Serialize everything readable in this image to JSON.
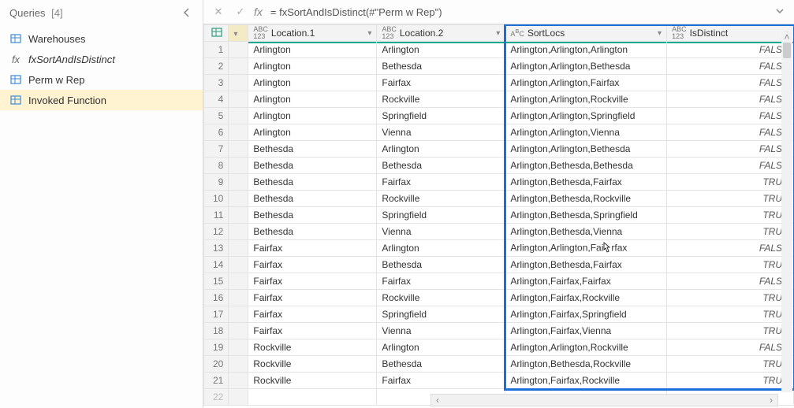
{
  "sidebar": {
    "title": "Queries",
    "count": "[4]",
    "items": [
      {
        "icon": "table",
        "label": "Warehouses"
      },
      {
        "icon": "fx",
        "label": "fxSortAndIsDistinct"
      },
      {
        "icon": "table",
        "label": "Perm w Rep"
      },
      {
        "icon": "table",
        "label": "Invoked Function"
      }
    ]
  },
  "formula": {
    "value": "= fxSortAndIsDistinct(#\"Perm w Rep\")"
  },
  "columns": [
    {
      "name": "Location.1",
      "typeicon": "ABC123"
    },
    {
      "name": "Location.2",
      "typeicon": "ABC123"
    },
    {
      "name": "SortLocs",
      "typeicon": "ABC"
    },
    {
      "name": "IsDistinct",
      "typeicon": "ABC123"
    }
  ],
  "rows": [
    {
      "n": 1,
      "c": [
        "Arlington",
        "Arlington",
        "Arlington,Arlington,Arlington",
        "FALSE"
      ]
    },
    {
      "n": 2,
      "c": [
        "Arlington",
        "Bethesda",
        "Arlington,Arlington,Bethesda",
        "FALSE"
      ]
    },
    {
      "n": 3,
      "c": [
        "Arlington",
        "Fairfax",
        "Arlington,Arlington,Fairfax",
        "FALSE"
      ]
    },
    {
      "n": 4,
      "c": [
        "Arlington",
        "Rockville",
        "Arlington,Arlington,Rockville",
        "FALSE"
      ]
    },
    {
      "n": 5,
      "c": [
        "Arlington",
        "Springfield",
        "Arlington,Arlington,Springfield",
        "FALSE"
      ]
    },
    {
      "n": 6,
      "c": [
        "Arlington",
        "Vienna",
        "Arlington,Arlington,Vienna",
        "FALSE"
      ]
    },
    {
      "n": 7,
      "c": [
        "Bethesda",
        "Arlington",
        "Arlington,Arlington,Bethesda",
        "FALSE"
      ]
    },
    {
      "n": 8,
      "c": [
        "Bethesda",
        "Bethesda",
        "Arlington,Bethesda,Bethesda",
        "FALSE"
      ]
    },
    {
      "n": 9,
      "c": [
        "Bethesda",
        "Fairfax",
        "Arlington,Bethesda,Fairfax",
        "TRUE"
      ]
    },
    {
      "n": 10,
      "c": [
        "Bethesda",
        "Rockville",
        "Arlington,Bethesda,Rockville",
        "TRUE"
      ]
    },
    {
      "n": 11,
      "c": [
        "Bethesda",
        "Springfield",
        "Arlington,Bethesda,Springfield",
        "TRUE"
      ]
    },
    {
      "n": 12,
      "c": [
        "Bethesda",
        "Vienna",
        "Arlington,Bethesda,Vienna",
        "TRUE"
      ]
    },
    {
      "n": 13,
      "c": [
        "Fairfax",
        "Arlington",
        "Arlington,Arlington,Fairfax",
        "FALSE"
      ]
    },
    {
      "n": 14,
      "c": [
        "Fairfax",
        "Bethesda",
        "Arlington,Bethesda,Fairfax",
        "TRUE"
      ]
    },
    {
      "n": 15,
      "c": [
        "Fairfax",
        "Fairfax",
        "Arlington,Fairfax,Fairfax",
        "FALSE"
      ]
    },
    {
      "n": 16,
      "c": [
        "Fairfax",
        "Rockville",
        "Arlington,Fairfax,Rockville",
        "TRUE"
      ]
    },
    {
      "n": 17,
      "c": [
        "Fairfax",
        "Springfield",
        "Arlington,Fairfax,Springfield",
        "TRUE"
      ]
    },
    {
      "n": 18,
      "c": [
        "Fairfax",
        "Vienna",
        "Arlington,Fairfax,Vienna",
        "TRUE"
      ]
    },
    {
      "n": 19,
      "c": [
        "Rockville",
        "Arlington",
        "Arlington,Arlington,Rockville",
        "FALSE"
      ]
    },
    {
      "n": 20,
      "c": [
        "Rockville",
        "Bethesda",
        "Arlington,Bethesda,Rockville",
        "TRUE"
      ]
    },
    {
      "n": 21,
      "c": [
        "Rockville",
        "Fairfax",
        "Arlington,Fairfax,Rockville",
        "TRUE"
      ]
    }
  ],
  "cursor_row": 13,
  "chart_data": {
    "type": "table",
    "columns": [
      "Location.1",
      "Location.2",
      "SortLocs",
      "IsDistinct"
    ],
    "rows": [
      [
        "Arlington",
        "Arlington",
        "Arlington,Arlington,Arlington",
        "FALSE"
      ],
      [
        "Arlington",
        "Bethesda",
        "Arlington,Arlington,Bethesda",
        "FALSE"
      ],
      [
        "Arlington",
        "Fairfax",
        "Arlington,Arlington,Fairfax",
        "FALSE"
      ],
      [
        "Arlington",
        "Rockville",
        "Arlington,Arlington,Rockville",
        "FALSE"
      ],
      [
        "Arlington",
        "Springfield",
        "Arlington,Arlington,Springfield",
        "FALSE"
      ],
      [
        "Arlington",
        "Vienna",
        "Arlington,Arlington,Vienna",
        "FALSE"
      ],
      [
        "Bethesda",
        "Arlington",
        "Arlington,Arlington,Bethesda",
        "FALSE"
      ],
      [
        "Bethesda",
        "Bethesda",
        "Arlington,Bethesda,Bethesda",
        "FALSE"
      ],
      [
        "Bethesda",
        "Fairfax",
        "Arlington,Bethesda,Fairfax",
        "TRUE"
      ],
      [
        "Bethesda",
        "Rockville",
        "Arlington,Bethesda,Rockville",
        "TRUE"
      ],
      [
        "Bethesda",
        "Springfield",
        "Arlington,Bethesda,Springfield",
        "TRUE"
      ],
      [
        "Bethesda",
        "Vienna",
        "Arlington,Bethesda,Vienna",
        "TRUE"
      ],
      [
        "Fairfax",
        "Arlington",
        "Arlington,Arlington,Fairfax",
        "FALSE"
      ],
      [
        "Fairfax",
        "Bethesda",
        "Arlington,Bethesda,Fairfax",
        "TRUE"
      ],
      [
        "Fairfax",
        "Fairfax",
        "Arlington,Fairfax,Fairfax",
        "FALSE"
      ],
      [
        "Fairfax",
        "Rockville",
        "Arlington,Fairfax,Rockville",
        "TRUE"
      ],
      [
        "Fairfax",
        "Springfield",
        "Arlington,Fairfax,Springfield",
        "TRUE"
      ],
      [
        "Fairfax",
        "Vienna",
        "Arlington,Fairfax,Vienna",
        "TRUE"
      ],
      [
        "Rockville",
        "Arlington",
        "Arlington,Arlington,Rockville",
        "FALSE"
      ],
      [
        "Rockville",
        "Bethesda",
        "Arlington,Bethesda,Rockville",
        "TRUE"
      ],
      [
        "Rockville",
        "Fairfax",
        "Arlington,Fairfax,Rockville",
        "TRUE"
      ]
    ]
  }
}
